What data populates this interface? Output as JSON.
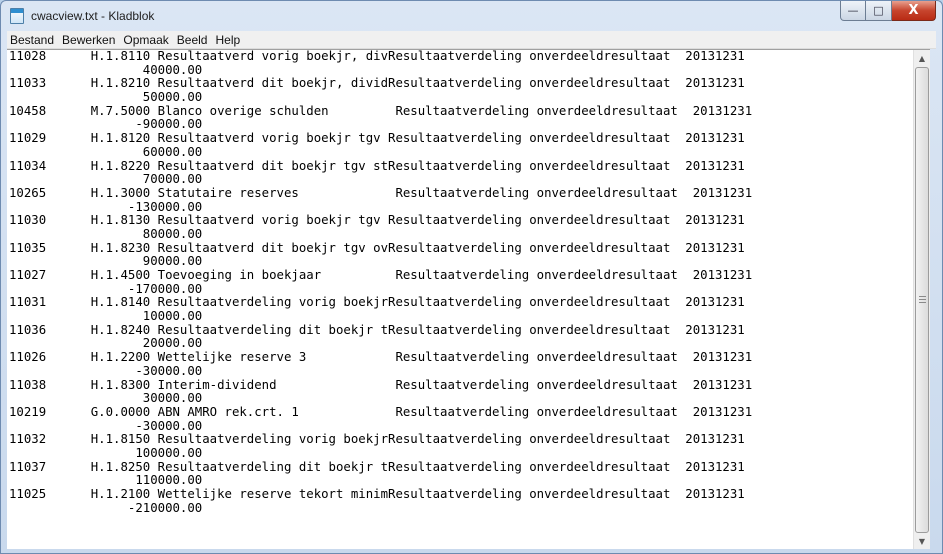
{
  "window": {
    "title": "cwacview.txt - Kladblok",
    "minimize_glyph": "—",
    "maximize_glyph": "□",
    "close_glyph": "X"
  },
  "menu": [
    "Bestand",
    "Bewerken",
    "Opmaak",
    "Beeld",
    "Help"
  ],
  "content": {
    "lines": [
      "11028      H.1.8110 Resultaatverd vorig boekjr, divResultaatverdeling onverdeeldresultaat  20131231",
      "                  40000.00",
      "11033      H.1.8210 Resultaatverd dit boekjr, dividResultaatverdeling onverdeeldresultaat  20131231",
      "                  50000.00",
      "10458      M.7.5000 Blanco overige schulden         Resultaatverdeling onverdeeldresultaat  20131231",
      "                 -90000.00",
      "11029      H.1.8120 Resultaatverd vorig boekjr tgv Resultaatverdeling onverdeeldresultaat  20131231",
      "                  60000.00",
      "11034      H.1.8220 Resultaatverd dit boekjr tgv stResultaatverdeling onverdeeldresultaat  20131231",
      "                  70000.00",
      "10265      H.1.3000 Statutaire reserves             Resultaatverdeling onverdeeldresultaat  20131231",
      "                -130000.00",
      "11030      H.1.8130 Resultaatverd vorig boekjr tgv Resultaatverdeling onverdeeldresultaat  20131231",
      "                  80000.00",
      "11035      H.1.8230 Resultaatverd dit boekjr tgv ovResultaatverdeling onverdeeldresultaat  20131231",
      "                  90000.00",
      "11027      H.1.4500 Toevoeging in boekjaar          Resultaatverdeling onverdeeldresultaat  20131231",
      "                -170000.00",
      "11031      H.1.8140 Resultaatverdeling vorig boekjrResultaatverdeling onverdeeldresultaat  20131231",
      "                  10000.00",
      "11036      H.1.8240 Resultaatverdeling dit boekjr tResultaatverdeling onverdeeldresultaat  20131231",
      "                  20000.00",
      "11026      H.1.2200 Wettelijke reserve 3            Resultaatverdeling onverdeeldresultaat  20131231",
      "                 -30000.00",
      "11038      H.1.8300 Interim-dividend                Resultaatverdeling onverdeeldresultaat  20131231",
      "                  30000.00",
      "10219      G.0.0000 ABN AMRO rek.crt. 1             Resultaatverdeling onverdeeldresultaat  20131231",
      "                 -30000.00",
      "11032      H.1.8150 Resultaatverdeling vorig boekjrResultaatverdeling onverdeeldresultaat  20131231",
      "                 100000.00",
      "11037      H.1.8250 Resultaatverdeling dit boekjr tResultaatverdeling onverdeeldresultaat  20131231",
      "                 110000.00",
      "11025      H.1.2100 Wettelijke reserve tekort minimResultaatverdeling onverdeeldresultaat  20131231",
      "                -210000.00"
    ]
  },
  "scrollbar": {
    "up_glyph": "▲",
    "down_glyph": "▼"
  },
  "icons": {
    "app": "notepad-icon",
    "minimize": "minimize-icon",
    "maximize": "maximize-icon",
    "close": "close-icon"
  }
}
